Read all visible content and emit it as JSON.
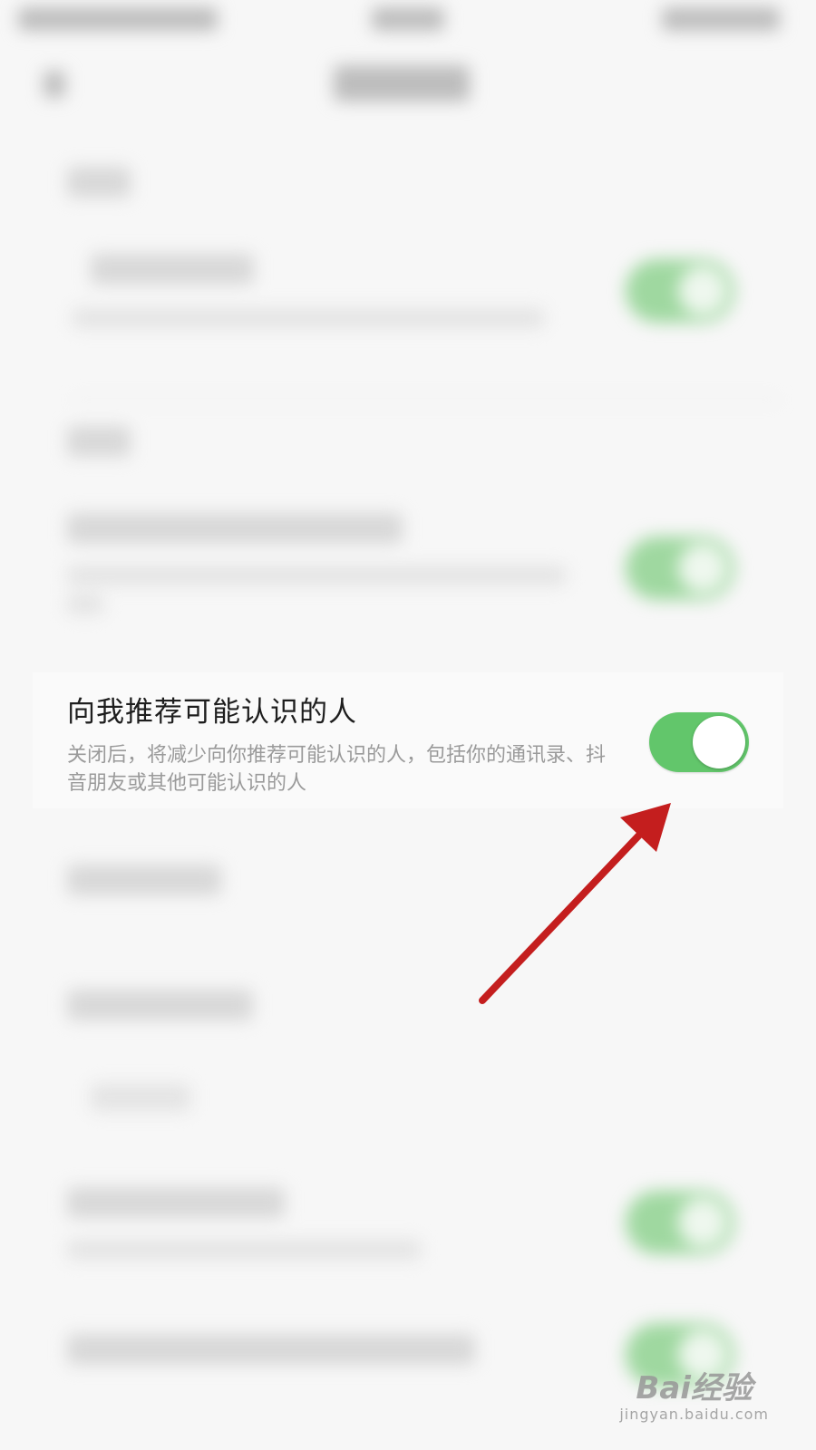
{
  "setting": {
    "title": "向我推荐可能认识的人",
    "description": "关闭后，将减少向你推荐可能认识的人，包括你的通讯录、抖音朋友或其他可能认识的人",
    "toggle_on": true
  },
  "colors": {
    "toggle_on": "#62c66b",
    "arrow": "#c41e1e",
    "background": "#f7f7f7"
  },
  "watermark": {
    "brand": "Bai经验",
    "url": "jingyan.baidu.com"
  },
  "icons": [
    "paw-icon"
  ]
}
